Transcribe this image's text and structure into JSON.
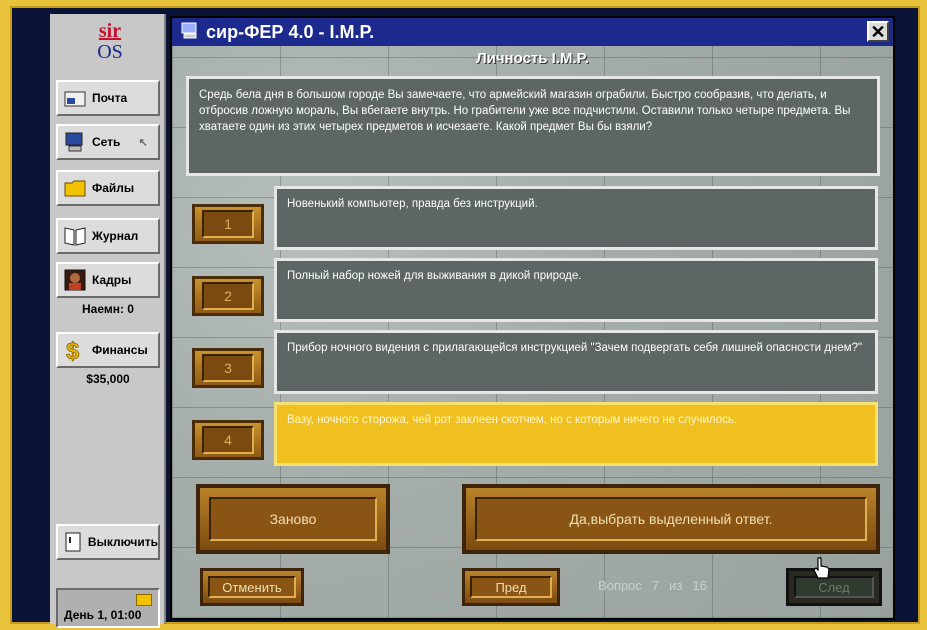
{
  "sidebar": {
    "logo_top": "sir",
    "logo_bottom": "OS",
    "items": [
      {
        "label": "Почта",
        "icon": "mail-icon"
      },
      {
        "label": "Сеть",
        "icon": "network-icon"
      },
      {
        "label": "Файлы",
        "icon": "folder-icon"
      },
      {
        "label": "Журнал",
        "icon": "book-icon"
      },
      {
        "label": "Кадры",
        "icon": "staff-icon"
      },
      {
        "label": "Финансы",
        "icon": "dollar-icon"
      }
    ],
    "hired": "Наемн: 0",
    "money": "$35,000",
    "shutdown_label": "Выключить",
    "clock": "День 1, 01:00"
  },
  "window": {
    "title": "сир-ФЕР 4.0 - I.M.P.",
    "heading": "Личность I.M.P.",
    "question": "Средь бела дня в большом городе Вы замечаете, что армейский магазин ограбили. Быстро сообразив, что делать, и отбросив ложную мораль, Вы вбегаете внутрь. Но грабители уже все подчистили. Оставили только четыре предмета. Вы хватаете один из этих четырех предметов и исчезаете. Какой предмет Вы бы взяли?",
    "answers": [
      {
        "num": "1",
        "text": "Новенький компьютер, правда без инструкций."
      },
      {
        "num": "2",
        "text": "Полный набор ножей для выживания в дикой природе."
      },
      {
        "num": "3",
        "text": "Прибор ночного видения с прилагающейся инструкцией \"Зачем подвергать себя лишней опасности днем?\""
      },
      {
        "num": "4",
        "text": "Вазу, ночного сторожа, чей рот заклеен скотчем, но с которым ничего не случилось."
      }
    ],
    "selected_answer": 4,
    "restart_label": "Заново",
    "confirm_label": "Да,выбрать выделенный ответ.",
    "cancel_label": "Отменить",
    "prev_label": "Пред",
    "next_label": "След",
    "counter": {
      "word": "Вопрос",
      "current": "7",
      "of": "из",
      "total": "16"
    }
  }
}
